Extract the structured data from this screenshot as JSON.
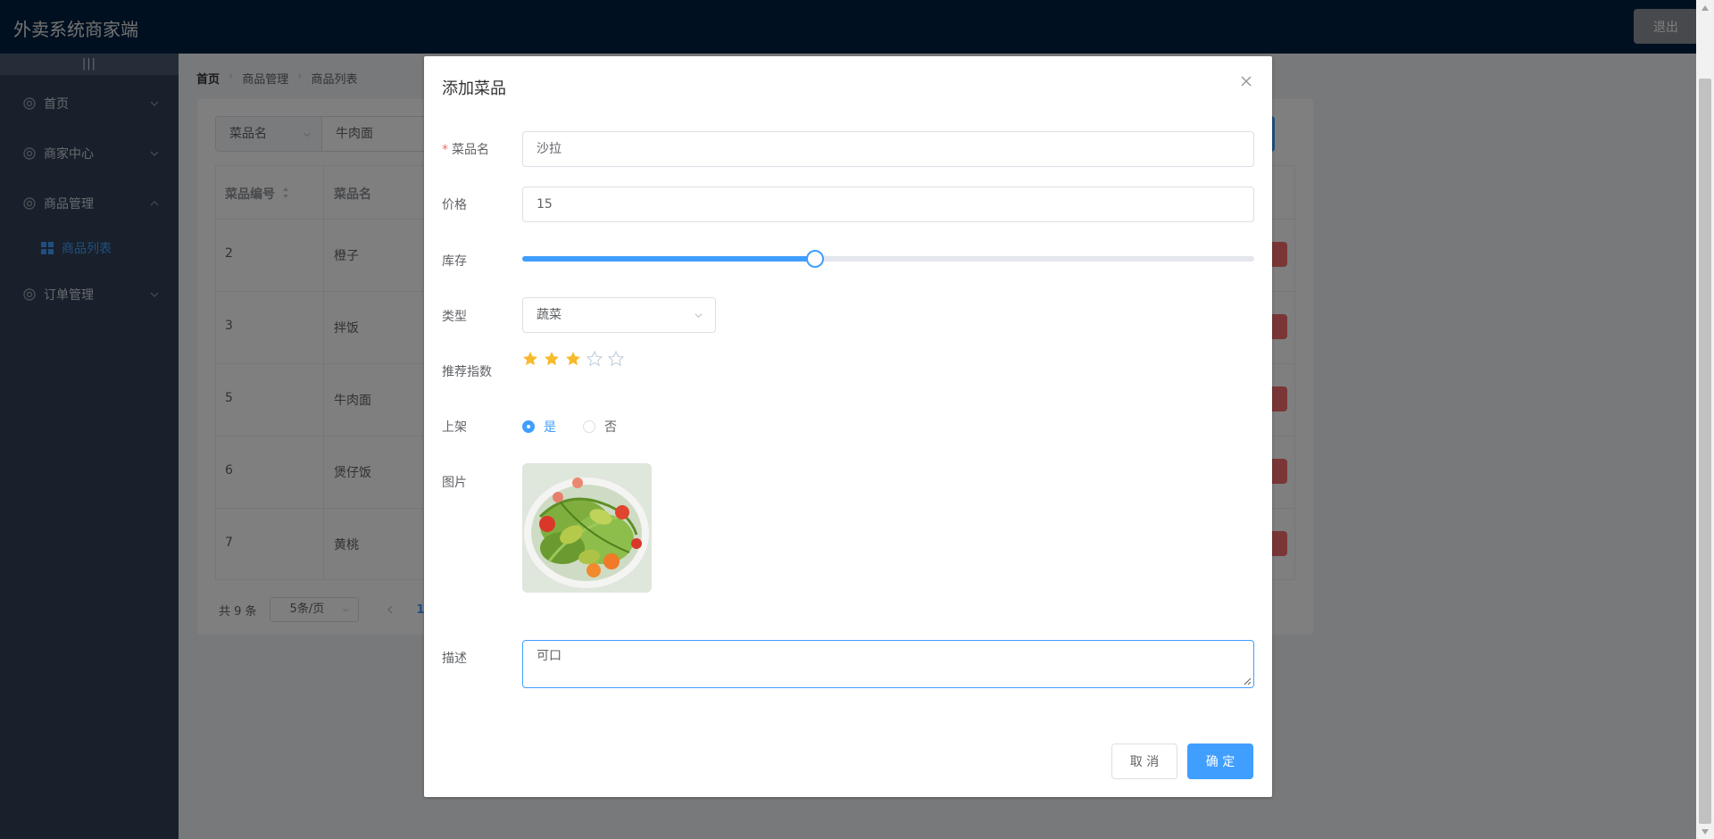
{
  "header": {
    "title": "外卖系统商家端",
    "logout_label": "退出"
  },
  "sidebar": {
    "collapse_glyph": "|||",
    "items": [
      {
        "label": "首页"
      },
      {
        "label": "商家中心"
      },
      {
        "label": "商品管理"
      },
      {
        "label": "商品列表"
      },
      {
        "label": "订单管理"
      }
    ]
  },
  "breadcrumb": [
    "首页",
    "商品管理",
    "商品列表"
  ],
  "search": {
    "field_label": "菜品名",
    "value": "牛肉面"
  },
  "table": {
    "columns": [
      "菜品编号",
      "菜品名"
    ],
    "rows": [
      {
        "id": "2",
        "name": "橙子"
      },
      {
        "id": "3",
        "name": "拌饭"
      },
      {
        "id": "5",
        "name": "牛肉面"
      },
      {
        "id": "6",
        "name": "煲仔饭"
      },
      {
        "id": "7",
        "name": "黄桃"
      }
    ]
  },
  "pagination": {
    "total": "共 9 条",
    "page_size": "5条/页",
    "current": "1"
  },
  "dialog": {
    "title": "添加菜品",
    "fields": {
      "name": {
        "label": "菜品名",
        "value": "沙拉",
        "required": true
      },
      "price": {
        "label": "价格",
        "value": "15"
      },
      "stock": {
        "label": "库存",
        "fraction": 0.4
      },
      "type": {
        "label": "类型",
        "value": "蔬菜"
      },
      "rating": {
        "label": "推荐指数",
        "value": 3,
        "max": 5
      },
      "listed": {
        "label": "上架",
        "options": [
          "是",
          "否"
        ],
        "selected": "是"
      },
      "image": {
        "label": "图片"
      },
      "desc": {
        "label": "描述",
        "value": "可口"
      }
    },
    "cancel_label": "取 消",
    "confirm_label": "确 定"
  },
  "colors": {
    "primary": "#409eff",
    "danger": "#f56c6c",
    "star": "#f7ba2a",
    "header_bg": "#002140",
    "sidebar_bg": "#304156"
  }
}
